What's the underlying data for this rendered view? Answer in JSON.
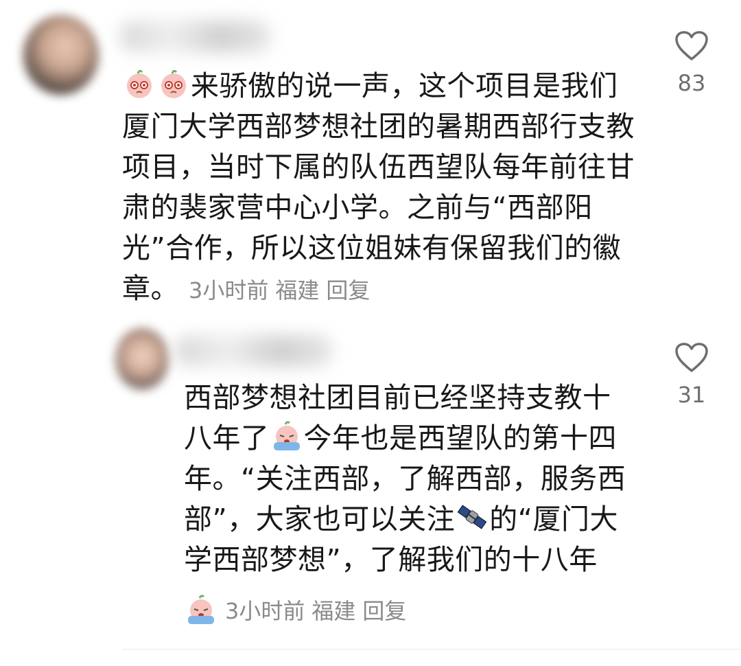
{
  "comments": [
    {
      "text_part1": "来骄傲的说一声，这个项目是我们厦门大学西部梦想社团的暑期西部行支教项目，当时下属的队伍西望队每年前往甘肃的裴家营中心小学。之前与“西部阳光”合作，所以这位姐妹有保留我们的徽章。",
      "emoji_prefix": [
        "pleading-peach-emoji",
        "pleading-peach-emoji"
      ],
      "time": "3小时前",
      "location": "福建",
      "reply": "回复",
      "likes": "83"
    },
    {
      "text_part1": "西部梦想社团目前已经坚持支教十八年了",
      "text_part2": "今年也是西望队的第十四年。“关注西部，了解西部，服务西部”，大家也可以关注",
      "text_part3": "的“厦门大学西部梦想”，了解我们的十八年",
      "emojis": [
        "crying-peach-emoji",
        "satellite-emoji",
        "crying-peach-emoji"
      ],
      "time": "3小时前",
      "location": "福建",
      "reply": "回复",
      "likes": "31"
    }
  ],
  "icons": {
    "like": "heart-outline-icon"
  },
  "colors": {
    "text": "#181818",
    "meta": "#8a8a8a",
    "like_count": "#6e6e6e"
  }
}
